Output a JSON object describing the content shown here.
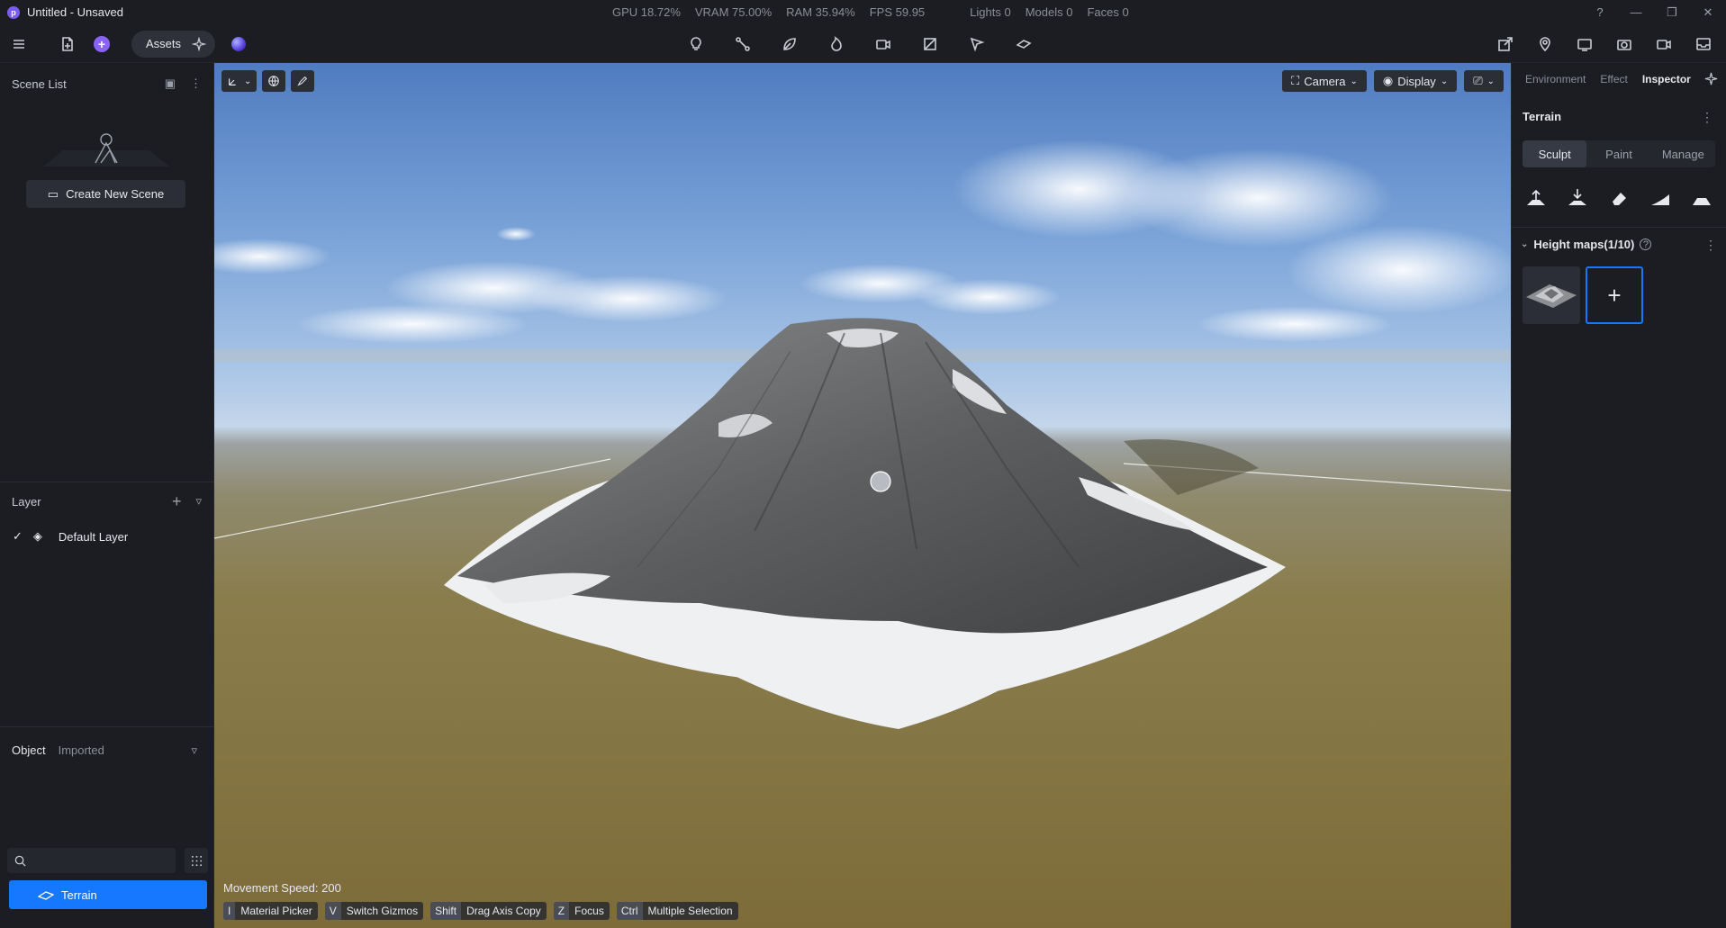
{
  "window": {
    "title": "Untitled - Unsaved",
    "logo_letter": "p"
  },
  "stats": {
    "gpu": "GPU 18.72%",
    "vram": "VRAM 75.00%",
    "ram": "RAM 35.94%",
    "fps": "FPS 59.95",
    "lights": "Lights 0",
    "models": "Models 0",
    "faces": "Faces 0"
  },
  "toolbar": {
    "assets_label": "Assets",
    "center_tools": [
      "light-bulb-icon",
      "path-tool-icon",
      "leaf-icon",
      "fire-icon",
      "video-camera-icon",
      "crop-icon",
      "pointer-flag-icon",
      "plane-icon"
    ],
    "right_tools": [
      "share-icon",
      "map-pin-icon",
      "screen-icon",
      "camera-icon",
      "record-icon",
      "inbox-icon"
    ]
  },
  "left_panel": {
    "scene_list_title": "Scene List",
    "create_scene_label": "Create New Scene",
    "layer_title": "Layer",
    "default_layer_label": "Default Layer",
    "object_tab": "Object",
    "imported_tab": "Imported",
    "search_placeholder": "",
    "selected_object": "Terrain"
  },
  "viewport": {
    "camera_label": "Camera",
    "display_label": "Display",
    "movement_speed": "Movement Speed: 200",
    "shortcuts": [
      {
        "key": "I",
        "label": "Material Picker"
      },
      {
        "key": "V",
        "label": "Switch Gizmos"
      },
      {
        "key": "Shift",
        "label": "Drag Axis Copy"
      },
      {
        "key": "Z",
        "label": "Focus"
      },
      {
        "key": "Ctrl",
        "label": "Multiple Selection"
      }
    ]
  },
  "right_panel": {
    "tabs": [
      "Environment",
      "Effect",
      "Inspector"
    ],
    "active_tab": "Inspector",
    "section_title": "Terrain",
    "modes": [
      "Sculpt",
      "Paint",
      "Manage"
    ],
    "active_mode": "Sculpt",
    "heightmaps_label": "Height maps(1/10)",
    "add_symbol": "+"
  },
  "colors": {
    "accent": "#1677ff",
    "brand_purple": "#8a63ff",
    "panel_bg": "#1b1d23"
  }
}
